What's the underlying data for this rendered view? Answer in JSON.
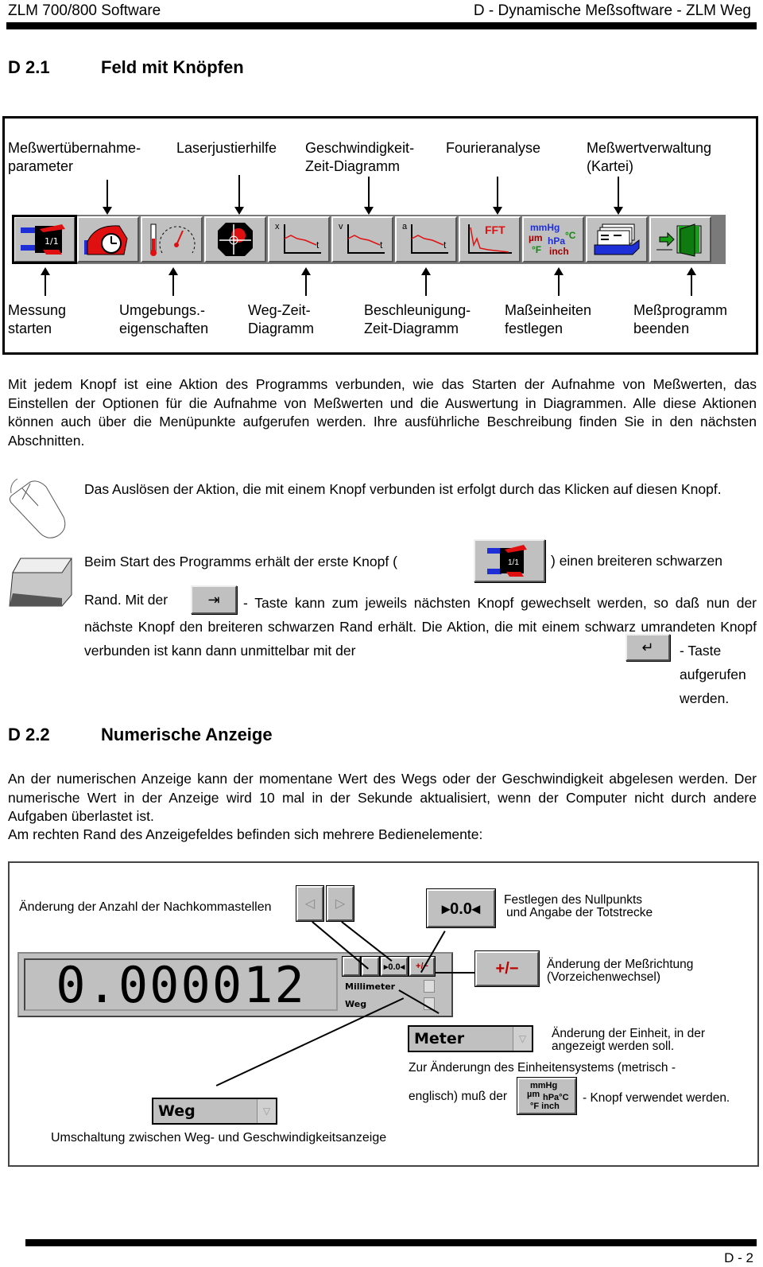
{
  "header": {
    "left": "ZLM 700/800 Software",
    "right": "D - Dynamische Meßsoftware - ZLM Weg"
  },
  "section1": {
    "number": "D 2.1",
    "title": "Feld mit Knöpfen",
    "top_labels": [
      {
        "line1": "Meßwertübernahme-",
        "line2": "parameter"
      },
      {
        "line1": "Laserjustierhilfe",
        "line2": ""
      },
      {
        "line1": "Geschwindigkeit-",
        "line2": "Zeit-Diagramm"
      },
      {
        "line1": "Fourieranalyse",
        "line2": ""
      },
      {
        "line1": "Meßwertverwaltung",
        "line2": "(Kartei)"
      }
    ],
    "toolbar_buttons": [
      {
        "icon": "start-measurement-icon",
        "active": true
      },
      {
        "icon": "stopwatch-hand-icon"
      },
      {
        "icon": "thermometer-gauge-icon"
      },
      {
        "icon": "laser-target-icon"
      },
      {
        "icon": "xt-diagram-icon",
        "axis": "x"
      },
      {
        "icon": "vt-diagram-icon",
        "axis": "v"
      },
      {
        "icon": "at-diagram-icon",
        "axis": "a"
      },
      {
        "icon": "fft-icon",
        "text": "FFT"
      },
      {
        "icon": "units-icon",
        "units": [
          "mmHg",
          "µm",
          "hPa",
          "°C",
          "°F",
          "inch"
        ]
      },
      {
        "icon": "card-index-icon"
      },
      {
        "icon": "exit-door-icon"
      }
    ],
    "bottom_labels": [
      {
        "line1": "Messung",
        "line2": "starten"
      },
      {
        "line1": "Umgebungs.-",
        "line2": "eigenschaften"
      },
      {
        "line1": "Weg-Zeit-",
        "line2": "Diagramm"
      },
      {
        "line1": "Beschleunigung-",
        "line2": "Zeit-Diagramm"
      },
      {
        "line1": "Maßeinheiten",
        "line2": "festlegen"
      },
      {
        "line1": "Meßprogramm",
        "line2": "beenden"
      }
    ],
    "paragraph": "Mit jedem Knopf ist eine Aktion des Programms verbunden, wie das Starten der Aufnahme von Meßwerten, das Einstellen der Optionen für die Aufnahme von Meßwerten und die Auswertung in Diagrammen. Alle diese Aktionen können auch über die Menüpunkte aufgerufen werden. Ihre ausführliche Beschreibung finden Sie in den nächsten Abschnitten.",
    "mouse_text": "Das Auslösen der Aktion, die mit einem Knopf verbunden ist erfolgt durch das Klicken auf diesen Knopf.",
    "keyboard_text": {
      "part1": "Beim Start des Programms erhält der erste Knopf (",
      "part2": ") einen breiteren schwarzen",
      "part3": "Rand. Mit der",
      "part4": "- Taste kann zum jeweils nächsten Knopf gewechselt werden, so daß nun der nächste Knopf den breiteren schwarzen Rand erhält. Die Aktion, die mit einem schwarz umrandeten Knopf verbunden ist kann dann unmittelbar mit der",
      "part5": "- Taste aufgerufen werden."
    }
  },
  "section2": {
    "number": "D 2.2",
    "title": "Numerische Anzeige",
    "paragraph1": "An der numerischen Anzeige kann der momentane Wert des Wegs oder der Geschwindigkeit abgelesen werden. Der numerische Wert in der Anzeige wird 10 mal in der Sekunde aktualisiert, wenn der Computer nicht durch andere Aufgaben überlastet ist.",
    "paragraph2": "Am rechten Rand des Anzeigefeldes befinden sich mehrere Bedienelemente:",
    "display": {
      "value": "0.000012",
      "unit": "Millimeter",
      "mode": "Weg",
      "zero_button": "▸0.0◂",
      "sign_button": "+/−"
    },
    "annotations": {
      "decimals": "Änderung der Anzahl der Nachkommastellen",
      "zero_line1": "Festlegen des Nullpunkts",
      "zero_line2": "und Angabe der Totstrecke",
      "sign_line1": "Änderung der Meßrichtung",
      "sign_line2": "(Vorzeichenwechsel)",
      "unit_line1": "Änderung der Einheit, in der",
      "unit_line2": "angezeigt werden soll.",
      "system_line1": "Zur Änderungn des Einheitensystems (metrisch -",
      "system_line2a": "englisch) muß der",
      "system_line2b": "- Knopf verwendet werden.",
      "mode": "Umschaltung zwischen Weg- und Geschwindigkeitsanzeige"
    },
    "unit_combo": "Meter",
    "mode_combo": "Weg",
    "zero_button_large": "▸0.0◂",
    "sign_button_large": "+/−"
  },
  "footer": {
    "page": "D - 2"
  }
}
